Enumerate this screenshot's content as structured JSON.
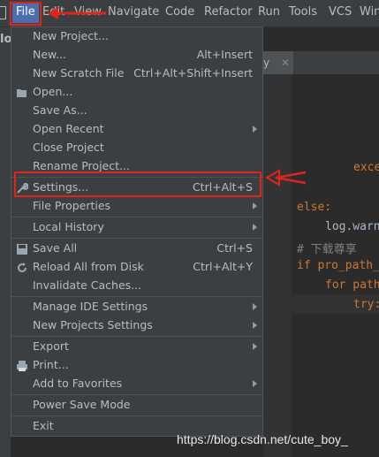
{
  "menubar": {
    "items": [
      "File",
      "Edit",
      "View",
      "Navigate",
      "Code",
      "Refactor",
      "Run",
      "Tools",
      "VCS",
      "Win"
    ],
    "partial_title": "lo"
  },
  "editor": {
    "tab_label": "y",
    "code_lines": [
      "exce",
      "else:",
      "log.warn",
      "# 下载尊享",
      "if pro_path_",
      "for path",
      "try:"
    ]
  },
  "file_menu": {
    "items": [
      {
        "label": "New Project...",
        "shortcut": ""
      },
      {
        "label": "New...",
        "shortcut": "Alt+Insert"
      },
      {
        "label": "New Scratch File",
        "shortcut": "Ctrl+Alt+Shift+Insert"
      },
      {
        "label": "Open...",
        "shortcut": ""
      },
      {
        "label": "Save As...",
        "shortcut": ""
      },
      {
        "label": "Open Recent",
        "shortcut": ""
      },
      {
        "label": "Close Project",
        "shortcut": ""
      },
      {
        "label": "Rename Project...",
        "shortcut": ""
      },
      {
        "label": "Settings...",
        "shortcut": "Ctrl+Alt+S"
      },
      {
        "label": "File Properties",
        "shortcut": ""
      },
      {
        "label": "Local History",
        "shortcut": ""
      },
      {
        "label": "Save All",
        "shortcut": "Ctrl+S"
      },
      {
        "label": "Reload All from Disk",
        "shortcut": "Ctrl+Alt+Y"
      },
      {
        "label": "Invalidate Caches...",
        "shortcut": ""
      },
      {
        "label": "Manage IDE Settings",
        "shortcut": ""
      },
      {
        "label": "New Projects Settings",
        "shortcut": ""
      },
      {
        "label": "Export",
        "shortcut": ""
      },
      {
        "label": "Print...",
        "shortcut": ""
      },
      {
        "label": "Add to Favorites",
        "shortcut": ""
      },
      {
        "label": "Power Save Mode",
        "shortcut": ""
      },
      {
        "label": "Exit",
        "shortcut": ""
      }
    ]
  },
  "watermark": "https://blog.csdn.net/cute_boy_",
  "colors": {
    "menu_bg": "#3c3f41",
    "selected_menu": "#4b6eaf",
    "annotation_red": "#e0241b",
    "keyword": "#cc7832"
  }
}
